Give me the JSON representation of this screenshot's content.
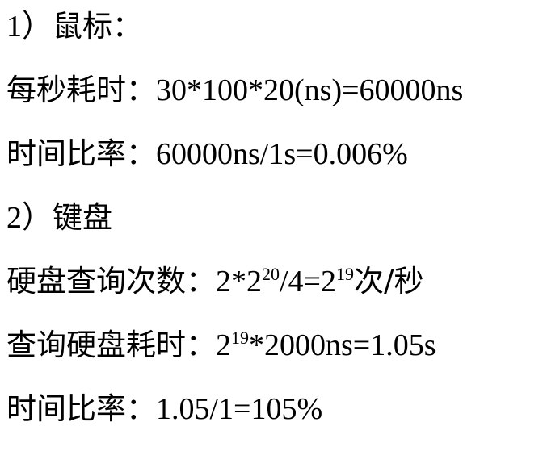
{
  "lines": {
    "mouse_heading": {
      "num": "1）",
      "text": "鼠标："
    },
    "mouse_time": {
      "label": "每秒耗时：",
      "expr": "30*100*20(ns)=60000ns"
    },
    "mouse_ratio": {
      "label": "时间比率：",
      "expr": "60000ns/1s=0.006%"
    },
    "keyboard_heading": {
      "num": "2）",
      "text": "键盘"
    },
    "disk_queries": {
      "label": "硬盘查询次数：",
      "a": "2*2",
      "exp1": "20",
      "b": "/4=2",
      "exp2": "19",
      "unit": "次/秒"
    },
    "disk_time": {
      "label": "查询硬盘耗时：",
      "a": "2",
      "exp1": "19",
      "b": "*2000ns=1.05s"
    },
    "disk_ratio": {
      "label": "时间比率：",
      "expr": "1.05/1=105%"
    }
  }
}
